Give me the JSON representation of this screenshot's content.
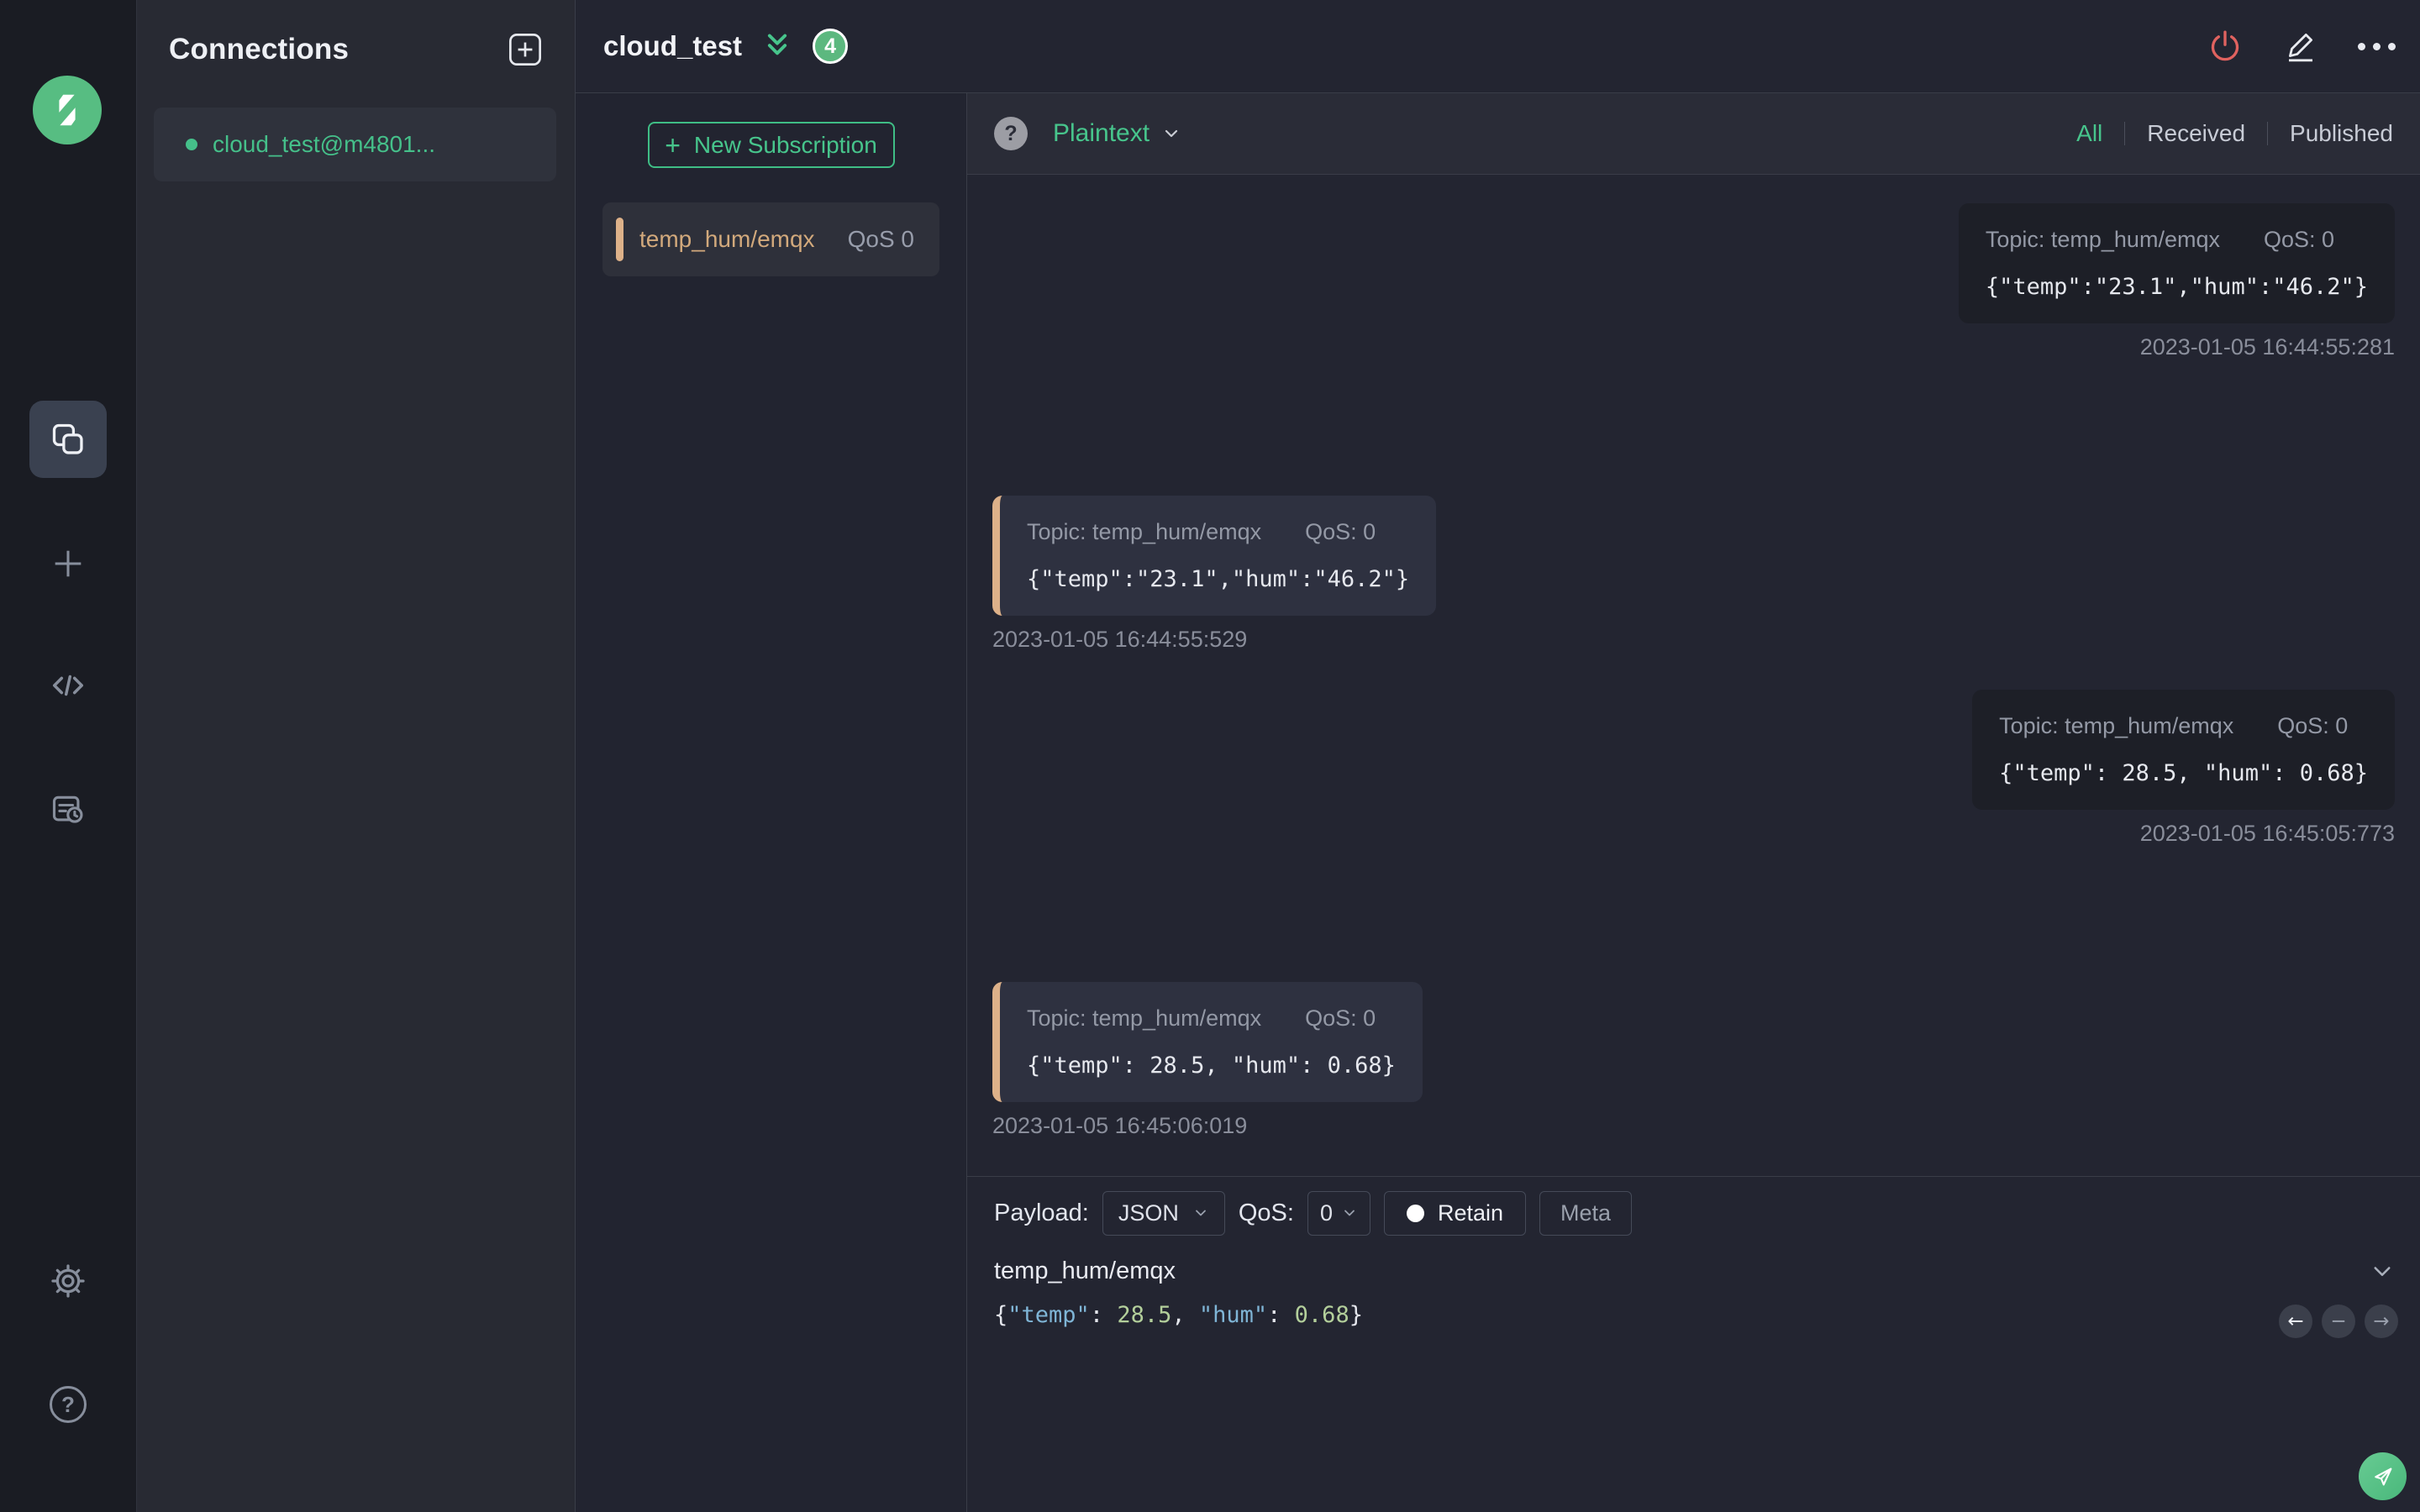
{
  "colors": {
    "accent_green": "#45c08a",
    "badge_green": "#5cb87f",
    "subscription_tan": "#ddb189",
    "danger_red": "#e0625f",
    "json_key_blue": "#7fb5d6",
    "json_number_green": "#b3cf9b"
  },
  "connections": {
    "title": "Connections",
    "items": [
      {
        "name": "cloud_test@m4801..."
      }
    ]
  },
  "header": {
    "title": "cloud_test",
    "badge": "4"
  },
  "subscriptions": {
    "new_button": "New Subscription",
    "plus": "+",
    "items": [
      {
        "topic": "temp_hum/emqx",
        "qos": "QoS 0"
      }
    ]
  },
  "toolbar": {
    "help": "?",
    "format": "Plaintext",
    "filters": {
      "all": "All",
      "received": "Received",
      "published": "Published"
    }
  },
  "messages": [
    {
      "direction": "published",
      "topic_label": "Topic: temp_hum/emqx",
      "qos_label": "QoS: 0",
      "payload": "{\"temp\":\"23.1\",\"hum\":\"46.2\"}",
      "timestamp": "2023-01-05 16:44:55:281"
    },
    {
      "direction": "received",
      "topic_label": "Topic: temp_hum/emqx",
      "qos_label": "QoS: 0",
      "payload": "{\"temp\":\"23.1\",\"hum\":\"46.2\"}",
      "timestamp": "2023-01-05 16:44:55:529"
    },
    {
      "direction": "published",
      "topic_label": "Topic: temp_hum/emqx",
      "qos_label": "QoS: 0",
      "payload": "{\"temp\": 28.5, \"hum\": 0.68}",
      "timestamp": "2023-01-05 16:45:05:773"
    },
    {
      "direction": "received",
      "topic_label": "Topic: temp_hum/emqx",
      "qos_label": "QoS: 0",
      "payload": "{\"temp\": 28.5, \"hum\": 0.68}",
      "timestamp": "2023-01-05 16:45:06:019"
    }
  ],
  "publish": {
    "payload_label": "Payload:",
    "format_value": "JSON",
    "qos_label": "QoS:",
    "qos_value": "0",
    "retain_label": "Retain",
    "meta_label": "Meta",
    "topic": "temp_hum/emqx",
    "tokens": [
      {
        "t": "{"
      },
      {
        "t": "\"temp\""
      },
      {
        "t": ": "
      },
      {
        "t": "28.5"
      },
      {
        "t": ", "
      },
      {
        "t": "\"hum\""
      },
      {
        "t": ": "
      },
      {
        "t": "0.68"
      },
      {
        "t": "}"
      }
    ]
  },
  "icons": {
    "history_prev": "←",
    "history_delete": "−",
    "history_next": "→",
    "rail_help": "?"
  }
}
